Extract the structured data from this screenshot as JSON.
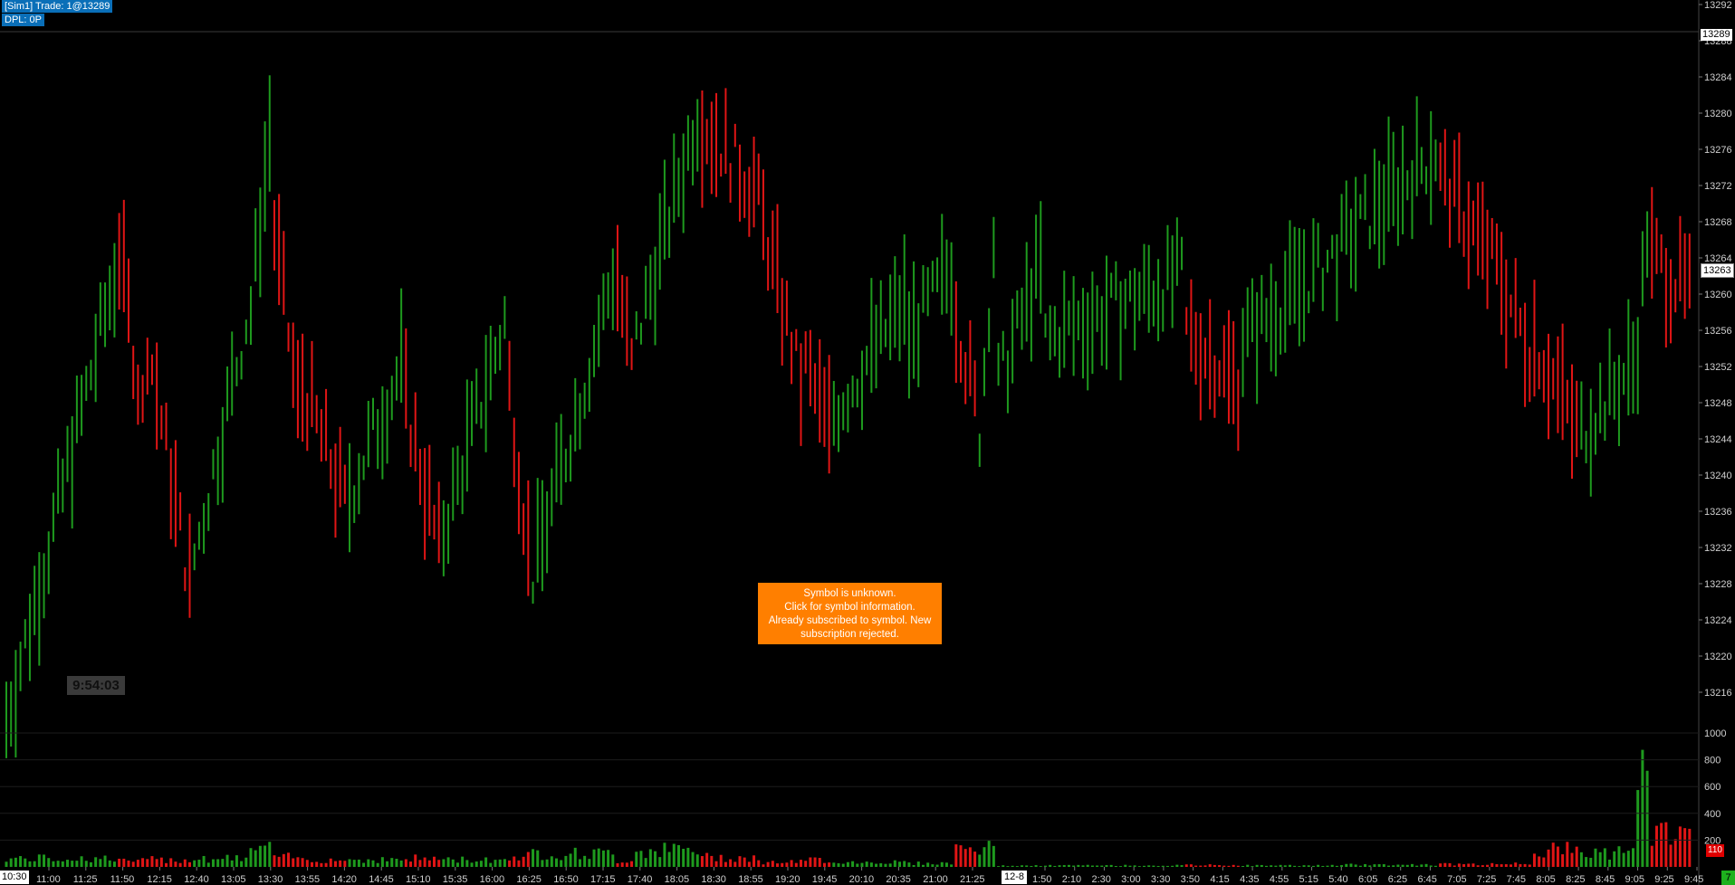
{
  "header": {
    "trade_line": "[Sim1]  Trade: 1@13289",
    "dpl_line": "DPL: 0P"
  },
  "clock": "9:54:03",
  "alert": {
    "lines": [
      "Symbol is unknown.",
      "Click for symbol information.",
      "Already subscribed to symbol.  New",
      "subscription rejected."
    ]
  },
  "markers": {
    "last_price": "13263",
    "trade_price": "13289",
    "last_volume": "110",
    "corner_label": "7",
    "start_time": "10:30",
    "day_label": "12-8"
  },
  "colors": {
    "up": "#1e9a1e",
    "down": "#e01515",
    "background": "#000000",
    "axis_text": "#cfcfcf",
    "info_bar": "#0a6fb8",
    "alert": "#ff7f00"
  },
  "chart_data": {
    "type": "bar",
    "price_axis": {
      "ticks": [
        13292,
        13288,
        13284,
        13280,
        13276,
        13272,
        13268,
        13264,
        13260,
        13256,
        13252,
        13248,
        13244,
        13240,
        13236,
        13232,
        13228,
        13224,
        13220,
        13216
      ],
      "range": [
        13213.5,
        13292.5
      ]
    },
    "volume_axis": {
      "ticks": [
        1000,
        800,
        600,
        400,
        200
      ],
      "range": [
        0,
        1000
      ]
    },
    "time_labels": [
      "11:00",
      "11:25",
      "11:50",
      "12:15",
      "12:40",
      "13:05",
      "13:30",
      "13:55",
      "14:20",
      "14:45",
      "15:10",
      "15:35",
      "16:00",
      "16:25",
      "16:50",
      "17:15",
      "17:40",
      "18:05",
      "18:30",
      "18:55",
      "19:20",
      "19:45",
      "20:10",
      "20:35",
      "21:00",
      "21:25",
      "1:50",
      "2:10",
      "2:30",
      "3:00",
      "3:30",
      "3:50",
      "4:15",
      "4:35",
      "4:55",
      "5:15",
      "5:40",
      "6:05",
      "6:25",
      "6:45",
      "7:05",
      "7:25",
      "7:45",
      "8:05",
      "8:25",
      "8:45",
      "9:05",
      "9:25",
      "9:45"
    ],
    "segments": [
      {
        "dir": "up",
        "count": 24,
        "from": 13213,
        "to": 13262,
        "vol": 70
      },
      {
        "dir": "down",
        "count": 6,
        "from": 13265,
        "to": 13247,
        "vol": 50
      },
      {
        "dir": "down",
        "count": 10,
        "from": 13255,
        "to": 13228,
        "vol": 60
      },
      {
        "dir": "up",
        "count": 12,
        "from": 13231,
        "to": 13257,
        "vol": 70
      },
      {
        "dir": "up",
        "count": 5,
        "from": 13258,
        "to": 13278,
        "vol": 150
      },
      {
        "dir": "down",
        "count": 6,
        "from": 13267,
        "to": 13248,
        "vol": 80
      },
      {
        "dir": "down",
        "count": 10,
        "from": 13250,
        "to": 13237,
        "vol": 60
      },
      {
        "dir": "up",
        "count": 12,
        "from": 13238,
        "to": 13252,
        "vol": 60
      },
      {
        "dir": "down",
        "count": 8,
        "from": 13248,
        "to": 13232,
        "vol": 70
      },
      {
        "dir": "up",
        "count": 14,
        "from": 13234,
        "to": 13257,
        "vol": 60
      },
      {
        "dir": "down",
        "count": 5,
        "from": 13250,
        "to": 13232,
        "vol": 90
      },
      {
        "dir": "up",
        "count": 18,
        "from": 13229,
        "to": 13262,
        "vol": 110
      },
      {
        "dir": "down",
        "count": 4,
        "from": 13262,
        "to": 13252,
        "vol": 50
      },
      {
        "dir": "up",
        "count": 14,
        "from": 13255,
        "to": 13280,
        "vol": 140
      },
      {
        "dir": "down",
        "count": 12,
        "from": 13279,
        "to": 13272,
        "vol": 80
      },
      {
        "dir": "down",
        "count": 10,
        "from": 13270,
        "to": 13250,
        "vol": 40
      },
      {
        "dir": "down",
        "count": 6,
        "from": 13252,
        "to": 13245,
        "vol": 60
      },
      {
        "dir": "up",
        "count": 16,
        "from": 13247,
        "to": 13259,
        "vol": 40
      },
      {
        "dir": "up",
        "count": 10,
        "from": 13255,
        "to": 13263,
        "vol": 30
      },
      {
        "dir": "down",
        "count": 5,
        "from": 13258,
        "to": 13248,
        "vol": 160
      },
      {
        "dir": "up",
        "count": 4,
        "from": 13245,
        "to": 13266,
        "vol": 150
      },
      {
        "dir": "up",
        "count": 10,
        "from": 13250,
        "to": 13263,
        "vol": 10
      },
      {
        "dir": "up",
        "count": 30,
        "from": 13255,
        "to": 13262,
        "vol": 12
      },
      {
        "dir": "down",
        "count": 12,
        "from": 13256,
        "to": 13250,
        "vol": 15
      },
      {
        "dir": "up",
        "count": 22,
        "from": 13255,
        "to": 13265,
        "vol": 12
      },
      {
        "dir": "up",
        "count": 20,
        "from": 13266,
        "to": 13276,
        "vol": 18
      },
      {
        "dir": "down",
        "count": 14,
        "from": 13273,
        "to": 13262,
        "vol": 22
      },
      {
        "dir": "down",
        "count": 6,
        "from": 13260,
        "to": 13254,
        "vol": 30
      },
      {
        "dir": "down",
        "count": 10,
        "from": 13255,
        "to": 13245,
        "vol": 140
      },
      {
        "dir": "up",
        "count": 12,
        "from": 13245,
        "to": 13252,
        "vol": 120
      },
      {
        "dir": "up",
        "count": 3,
        "from": 13255,
        "to": 13267,
        "vol": 700
      },
      {
        "dir": "down",
        "count": 9,
        "from": 13264,
        "to": 13260,
        "vol": 300
      }
    ]
  }
}
